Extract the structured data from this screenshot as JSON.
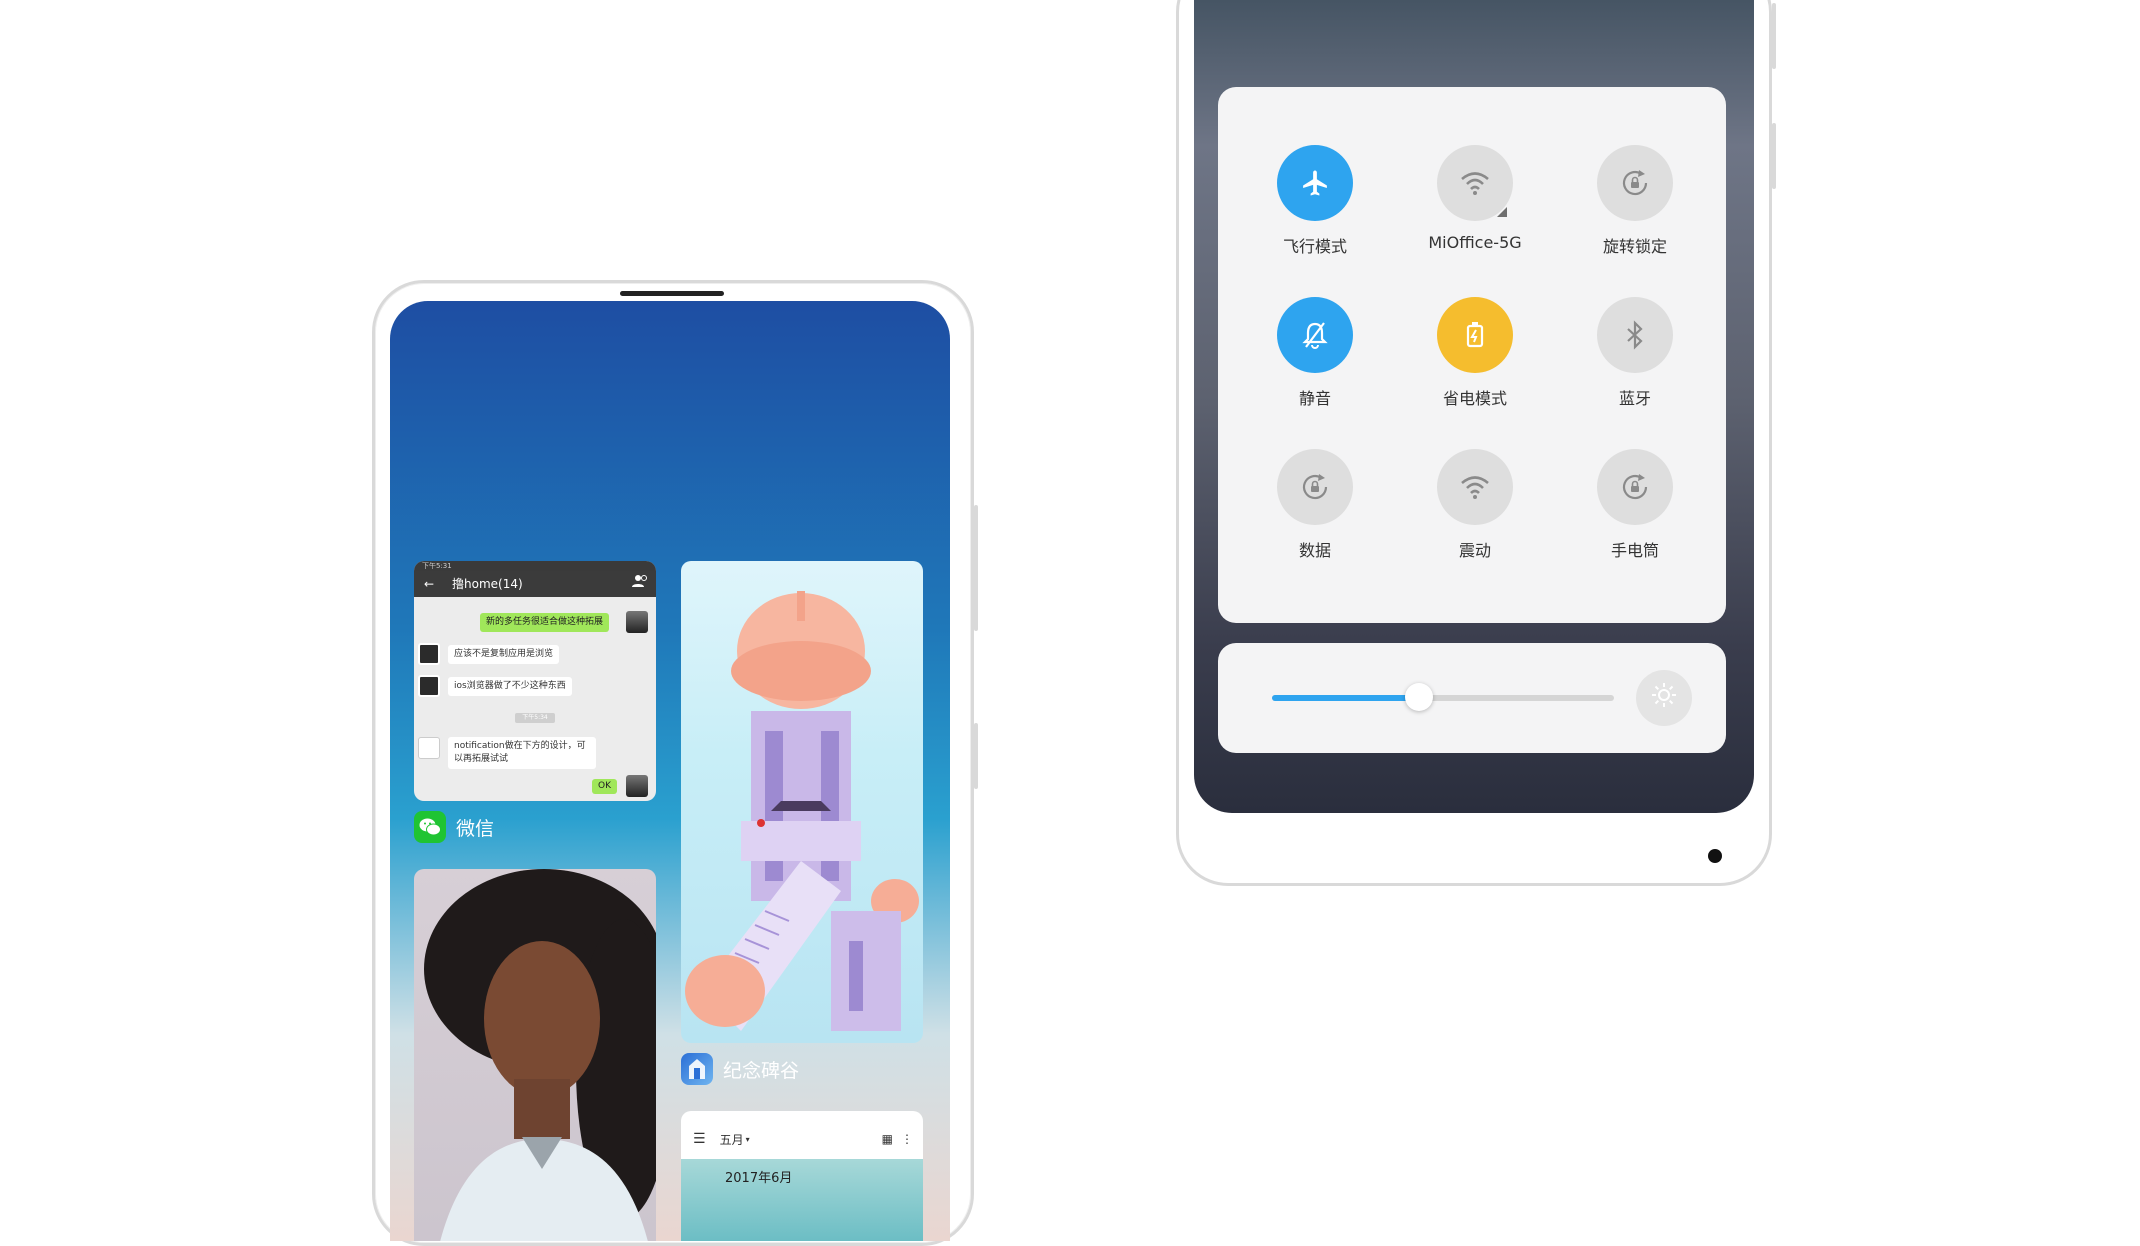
{
  "left_phone": {
    "wechat_card": {
      "status_time": "下午5:31",
      "chat_title": "撸home(14)",
      "messages": [
        {
          "side": "right",
          "text": "新的多任务很适合做这种拓展"
        },
        {
          "side": "left",
          "text": "应该不是复制应用是浏览"
        },
        {
          "side": "left",
          "text": "ios浏览器做了不少这种东西"
        },
        {
          "side": "left",
          "text": "notification做在下方的设计，可以再拓展试试"
        },
        {
          "side": "right",
          "text": "OK"
        }
      ],
      "time_chip": "下午5:34",
      "app_name": "微信"
    },
    "monument_card": {
      "app_name": "纪念碑谷"
    },
    "portrait_card": {},
    "calendar_card": {
      "month_label": "五月",
      "date_label": "2017年6月"
    }
  },
  "right_phone": {
    "toggles": [
      {
        "label": "飞行模式",
        "icon": "airplane-icon",
        "state": "on",
        "color": "#2ea4ef"
      },
      {
        "label": "MiOffice-5G",
        "icon": "wifi-icon",
        "state": "off"
      },
      {
        "label": "旋转锁定",
        "icon": "rotation-lock-icon",
        "state": "off"
      },
      {
        "label": "静音",
        "icon": "bell-mute-icon",
        "state": "on",
        "color": "#2ea4ef"
      },
      {
        "label": "省电模式",
        "icon": "battery-saver-icon",
        "state": "on",
        "color": "#f5bd2e"
      },
      {
        "label": "蓝牙",
        "icon": "bluetooth-icon",
        "state": "off"
      },
      {
        "label": "数据",
        "icon": "data-icon",
        "state": "off"
      },
      {
        "label": "震动",
        "icon": "vibrate-icon",
        "state": "off"
      },
      {
        "label": "手电筒",
        "icon": "flashlight-icon",
        "state": "off"
      }
    ],
    "brightness": {
      "level": 0.43,
      "icon": "sun-icon"
    }
  }
}
